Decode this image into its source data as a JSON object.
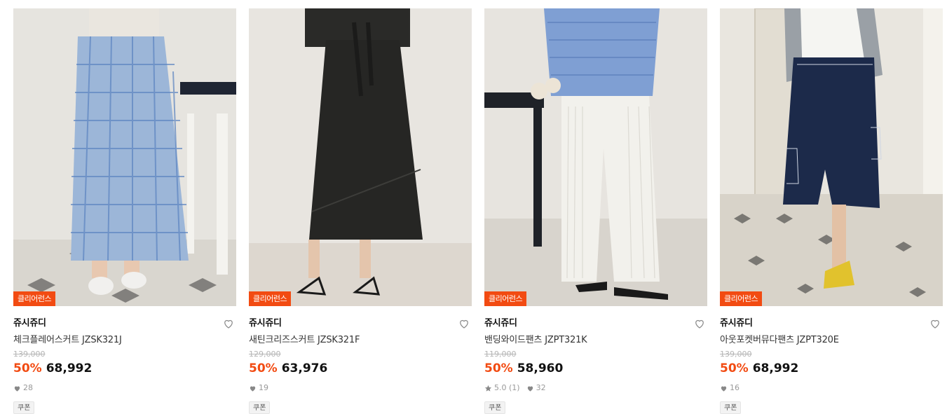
{
  "colors": {
    "accent": "#f24b12",
    "text": "#111111",
    "muted": "#999999"
  },
  "products": [
    {
      "badge": "클리어런스",
      "brand": "쥬시쥬디",
      "name": "체크플레어스커트 JZSK321J",
      "original_price": "139,000",
      "discount": "50%",
      "price": "68,992",
      "likes": "28",
      "rating": "",
      "coupon": "쿠폰"
    },
    {
      "badge": "클리어런스",
      "brand": "쥬시쥬디",
      "name": "새틴크리즈스커트 JZSK321F",
      "original_price": "129,000",
      "discount": "50%",
      "price": "63,976",
      "likes": "19",
      "rating": "",
      "coupon": "쿠폰"
    },
    {
      "badge": "클리어런스",
      "brand": "쥬시쥬디",
      "name": "밴딩와이드팬츠 JZPT321K",
      "original_price": "119,000",
      "discount": "50%",
      "price": "58,960",
      "likes": "32",
      "rating": "5.0 (1)",
      "coupon": "쿠폰"
    },
    {
      "badge": "클리어런스",
      "brand": "쥬시쥬디",
      "name": "아웃포켓버뮤다팬츠 JZPT320E",
      "original_price": "139,000",
      "discount": "50%",
      "price": "68,992",
      "likes": "16",
      "rating": "",
      "coupon": "쿠폰"
    }
  ]
}
